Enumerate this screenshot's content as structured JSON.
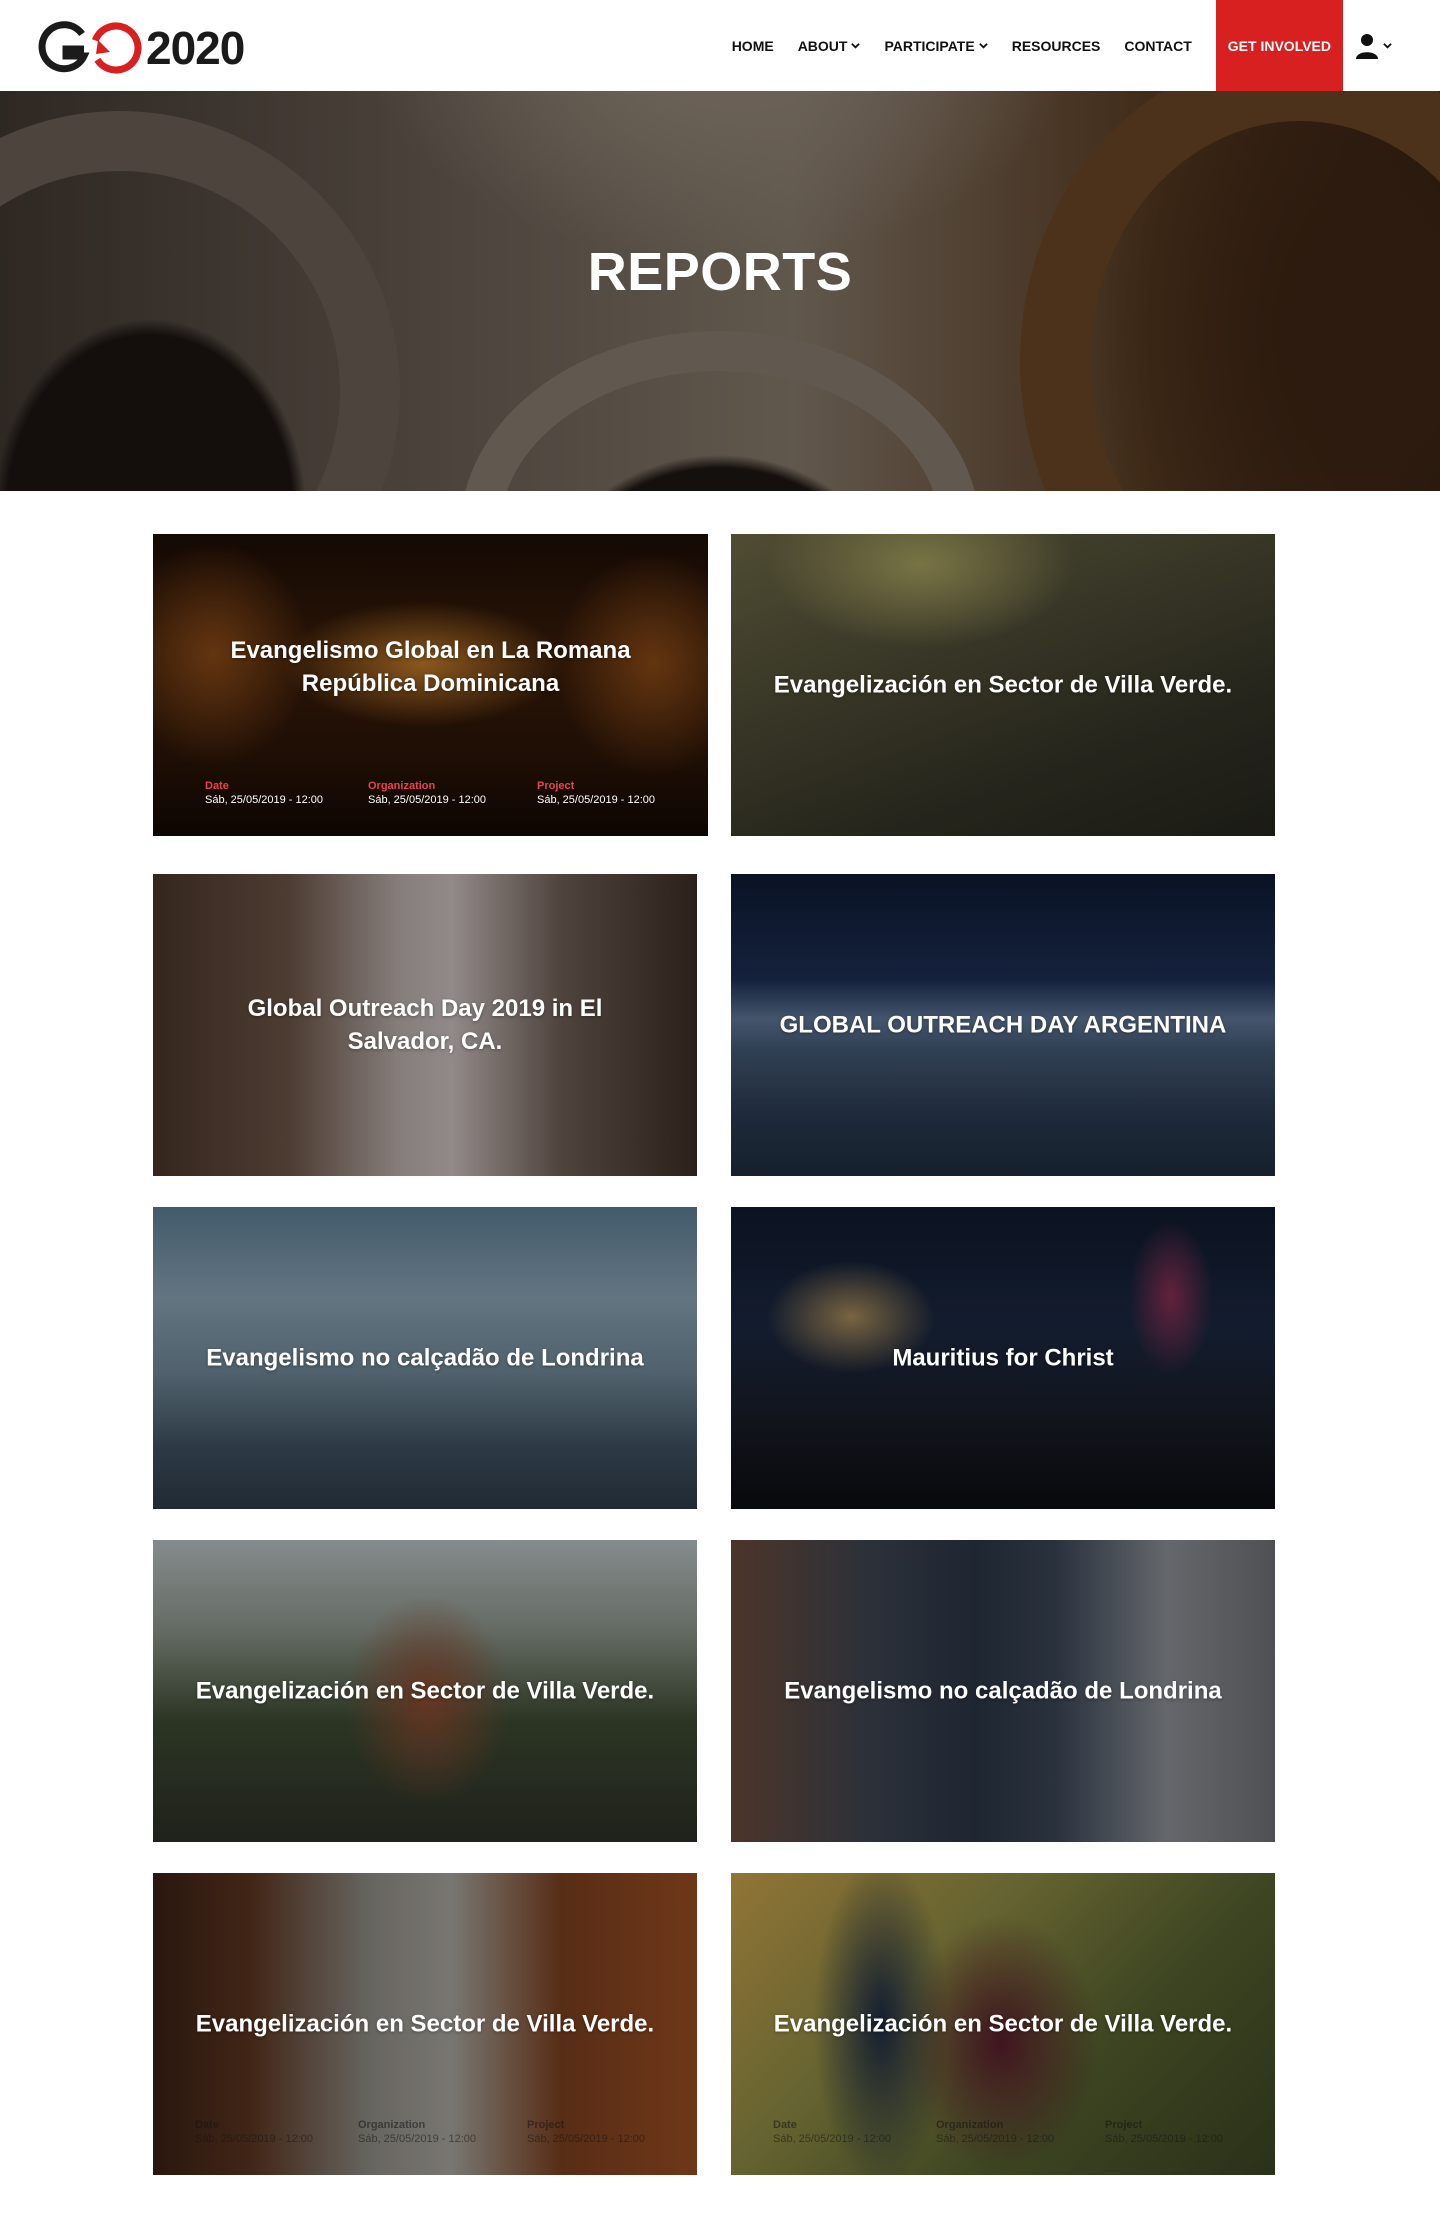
{
  "header": {
    "logo": {
      "text": "2020",
      "mark_letters": "GO"
    },
    "nav": [
      {
        "label": "HOME",
        "has_dropdown": false
      },
      {
        "label": "ABOUT",
        "has_dropdown": true
      },
      {
        "label": "PARTICIPATE",
        "has_dropdown": true
      },
      {
        "label": "RESOURCES",
        "has_dropdown": false
      },
      {
        "label": "CONTACT",
        "has_dropdown": false
      }
    ],
    "cta_label": "GET INVOLVED",
    "user_icon": "user-icon",
    "accent_color": "#d7201f"
  },
  "hero": {
    "title": "REPORTS"
  },
  "meta_labels": {
    "date": "Date",
    "organization": "Organization",
    "project": "Project"
  },
  "reports": [
    {
      "title": "Evangelismo Global en La Romana República Dominicana",
      "date": "Sáb, 25/05/2019 - 12:00",
      "organization": "Sáb, 25/05/2019 - 12:00",
      "project": "Sáb, 25/05/2019 - 12:00"
    },
    {
      "title": "Evangelización en Sector de Villa Verde."
    },
    {
      "title": "Global Outreach Day 2019 in El Salvador, CA."
    },
    {
      "title": "GLOBAL OUTREACH DAY ARGENTINA"
    },
    {
      "title": "Evangelismo no calçadão de Londrina"
    },
    {
      "title": "Mauritius for Christ"
    },
    {
      "title": "Evangelización en Sector de Villa Verde."
    },
    {
      "title": "Evangelismo no calçadão de Londrina"
    },
    {
      "title": "Evangelización en Sector de Villa Verde.",
      "date": "Sáb, 25/05/2019 - 12:00",
      "organization": "Sáb, 25/05/2019 - 12:00",
      "project": "Sáb, 25/05/2019 - 12:00"
    },
    {
      "title": "Evangelización en Sector de Villa Verde.",
      "date": "Sáb, 25/05/2019 - 12:00",
      "organization": "Sáb, 25/05/2019 - 12:00",
      "project": "Sáb, 25/05/2019 - 12:00"
    }
  ]
}
